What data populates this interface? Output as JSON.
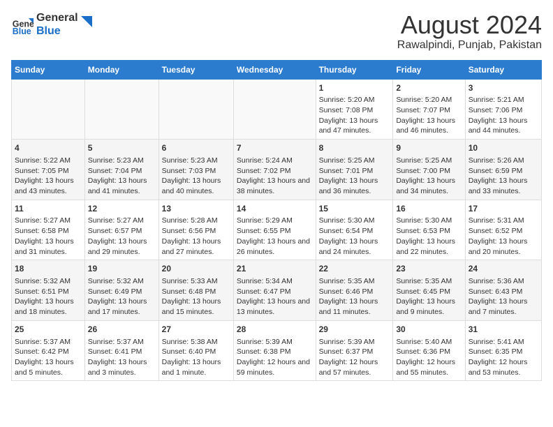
{
  "header": {
    "logo_general": "General",
    "logo_blue": "Blue",
    "main_title": "August 2024",
    "subtitle": "Rawalpindi, Punjab, Pakistan"
  },
  "days_of_week": [
    "Sunday",
    "Monday",
    "Tuesday",
    "Wednesday",
    "Thursday",
    "Friday",
    "Saturday"
  ],
  "weeks": [
    {
      "cells": [
        {
          "day": "",
          "empty": true
        },
        {
          "day": "",
          "empty": true
        },
        {
          "day": "",
          "empty": true
        },
        {
          "day": "",
          "empty": true
        },
        {
          "day": "1",
          "sunrise": "Sunrise: 5:20 AM",
          "sunset": "Sunset: 7:08 PM",
          "daylight": "Daylight: 13 hours and 47 minutes."
        },
        {
          "day": "2",
          "sunrise": "Sunrise: 5:20 AM",
          "sunset": "Sunset: 7:07 PM",
          "daylight": "Daylight: 13 hours and 46 minutes."
        },
        {
          "day": "3",
          "sunrise": "Sunrise: 5:21 AM",
          "sunset": "Sunset: 7:06 PM",
          "daylight": "Daylight: 13 hours and 44 minutes."
        }
      ]
    },
    {
      "cells": [
        {
          "day": "4",
          "sunrise": "Sunrise: 5:22 AM",
          "sunset": "Sunset: 7:05 PM",
          "daylight": "Daylight: 13 hours and 43 minutes."
        },
        {
          "day": "5",
          "sunrise": "Sunrise: 5:23 AM",
          "sunset": "Sunset: 7:04 PM",
          "daylight": "Daylight: 13 hours and 41 minutes."
        },
        {
          "day": "6",
          "sunrise": "Sunrise: 5:23 AM",
          "sunset": "Sunset: 7:03 PM",
          "daylight": "Daylight: 13 hours and 40 minutes."
        },
        {
          "day": "7",
          "sunrise": "Sunrise: 5:24 AM",
          "sunset": "Sunset: 7:02 PM",
          "daylight": "Daylight: 13 hours and 38 minutes."
        },
        {
          "day": "8",
          "sunrise": "Sunrise: 5:25 AM",
          "sunset": "Sunset: 7:01 PM",
          "daylight": "Daylight: 13 hours and 36 minutes."
        },
        {
          "day": "9",
          "sunrise": "Sunrise: 5:25 AM",
          "sunset": "Sunset: 7:00 PM",
          "daylight": "Daylight: 13 hours and 34 minutes."
        },
        {
          "day": "10",
          "sunrise": "Sunrise: 5:26 AM",
          "sunset": "Sunset: 6:59 PM",
          "daylight": "Daylight: 13 hours and 33 minutes."
        }
      ]
    },
    {
      "cells": [
        {
          "day": "11",
          "sunrise": "Sunrise: 5:27 AM",
          "sunset": "Sunset: 6:58 PM",
          "daylight": "Daylight: 13 hours and 31 minutes."
        },
        {
          "day": "12",
          "sunrise": "Sunrise: 5:27 AM",
          "sunset": "Sunset: 6:57 PM",
          "daylight": "Daylight: 13 hours and 29 minutes."
        },
        {
          "day": "13",
          "sunrise": "Sunrise: 5:28 AM",
          "sunset": "Sunset: 6:56 PM",
          "daylight": "Daylight: 13 hours and 27 minutes."
        },
        {
          "day": "14",
          "sunrise": "Sunrise: 5:29 AM",
          "sunset": "Sunset: 6:55 PM",
          "daylight": "Daylight: 13 hours and 26 minutes."
        },
        {
          "day": "15",
          "sunrise": "Sunrise: 5:30 AM",
          "sunset": "Sunset: 6:54 PM",
          "daylight": "Daylight: 13 hours and 24 minutes."
        },
        {
          "day": "16",
          "sunrise": "Sunrise: 5:30 AM",
          "sunset": "Sunset: 6:53 PM",
          "daylight": "Daylight: 13 hours and 22 minutes."
        },
        {
          "day": "17",
          "sunrise": "Sunrise: 5:31 AM",
          "sunset": "Sunset: 6:52 PM",
          "daylight": "Daylight: 13 hours and 20 minutes."
        }
      ]
    },
    {
      "cells": [
        {
          "day": "18",
          "sunrise": "Sunrise: 5:32 AM",
          "sunset": "Sunset: 6:51 PM",
          "daylight": "Daylight: 13 hours and 18 minutes."
        },
        {
          "day": "19",
          "sunrise": "Sunrise: 5:32 AM",
          "sunset": "Sunset: 6:49 PM",
          "daylight": "Daylight: 13 hours and 17 minutes."
        },
        {
          "day": "20",
          "sunrise": "Sunrise: 5:33 AM",
          "sunset": "Sunset: 6:48 PM",
          "daylight": "Daylight: 13 hours and 15 minutes."
        },
        {
          "day": "21",
          "sunrise": "Sunrise: 5:34 AM",
          "sunset": "Sunset: 6:47 PM",
          "daylight": "Daylight: 13 hours and 13 minutes."
        },
        {
          "day": "22",
          "sunrise": "Sunrise: 5:35 AM",
          "sunset": "Sunset: 6:46 PM",
          "daylight": "Daylight: 13 hours and 11 minutes."
        },
        {
          "day": "23",
          "sunrise": "Sunrise: 5:35 AM",
          "sunset": "Sunset: 6:45 PM",
          "daylight": "Daylight: 13 hours and 9 minutes."
        },
        {
          "day": "24",
          "sunrise": "Sunrise: 5:36 AM",
          "sunset": "Sunset: 6:43 PM",
          "daylight": "Daylight: 13 hours and 7 minutes."
        }
      ]
    },
    {
      "cells": [
        {
          "day": "25",
          "sunrise": "Sunrise: 5:37 AM",
          "sunset": "Sunset: 6:42 PM",
          "daylight": "Daylight: 13 hours and 5 minutes."
        },
        {
          "day": "26",
          "sunrise": "Sunrise: 5:37 AM",
          "sunset": "Sunset: 6:41 PM",
          "daylight": "Daylight: 13 hours and 3 minutes."
        },
        {
          "day": "27",
          "sunrise": "Sunrise: 5:38 AM",
          "sunset": "Sunset: 6:40 PM",
          "daylight": "Daylight: 13 hours and 1 minute."
        },
        {
          "day": "28",
          "sunrise": "Sunrise: 5:39 AM",
          "sunset": "Sunset: 6:38 PM",
          "daylight": "Daylight: 12 hours and 59 minutes."
        },
        {
          "day": "29",
          "sunrise": "Sunrise: 5:39 AM",
          "sunset": "Sunset: 6:37 PM",
          "daylight": "Daylight: 12 hours and 57 minutes."
        },
        {
          "day": "30",
          "sunrise": "Sunrise: 5:40 AM",
          "sunset": "Sunset: 6:36 PM",
          "daylight": "Daylight: 12 hours and 55 minutes."
        },
        {
          "day": "31",
          "sunrise": "Sunrise: 5:41 AM",
          "sunset": "Sunset: 6:35 PM",
          "daylight": "Daylight: 12 hours and 53 minutes."
        }
      ]
    }
  ]
}
